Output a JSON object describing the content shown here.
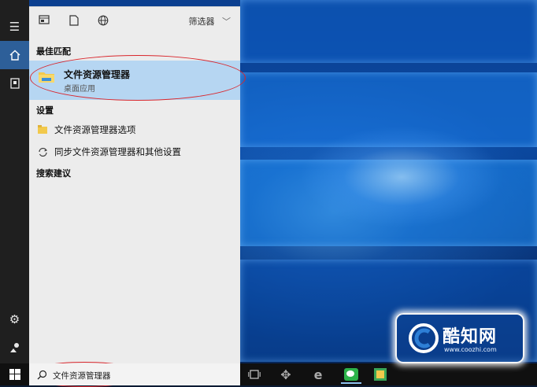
{
  "toolbar": {
    "filter_label": "筛选器"
  },
  "sections": {
    "best_match": "最佳匹配",
    "settings": "设置",
    "search_suggestions": "搜索建议"
  },
  "best_match": {
    "title": "文件资源管理器",
    "subtitle": "桌面应用"
  },
  "settings_items": [
    {
      "label": "文件资源管理器选项"
    },
    {
      "label": "同步文件资源管理器和其他设置"
    }
  ],
  "search": {
    "query": "文件资源管理器"
  },
  "watermark": {
    "brand": "酷知网",
    "url": "www.coozhi.com"
  },
  "colors": {
    "accent": "#2d5f99",
    "highlight": "#b6d6f2",
    "annotation": "#d9262c"
  }
}
